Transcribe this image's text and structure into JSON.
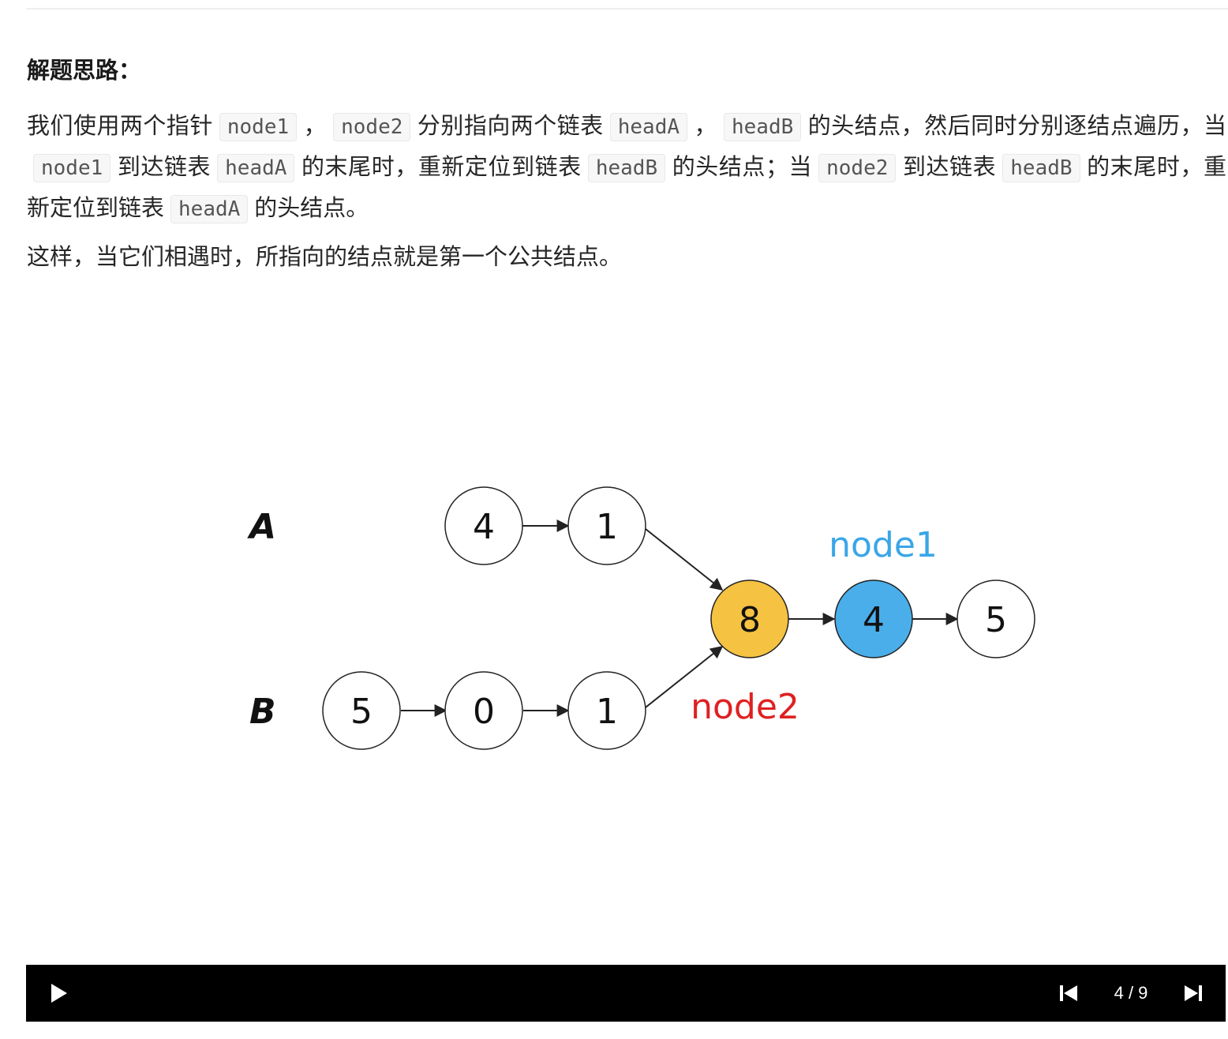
{
  "heading": "解题思路：",
  "paragraph1": [
    {
      "t": "text",
      "v": "我们使用两个指针"
    },
    {
      "t": "code",
      "v": "node1"
    },
    {
      "t": "text",
      "v": "，"
    },
    {
      "t": "code",
      "v": "node2"
    },
    {
      "t": "text",
      "v": "分别指向两个链表"
    },
    {
      "t": "code",
      "v": "headA"
    },
    {
      "t": "text",
      "v": "，"
    },
    {
      "t": "code",
      "v": "headB"
    },
    {
      "t": "text",
      "v": "的头结点，然后同时分别逐结点遍历，当"
    },
    {
      "t": "code",
      "v": "node1"
    },
    {
      "t": "text",
      "v": "到达链表"
    },
    {
      "t": "code",
      "v": "headA"
    },
    {
      "t": "text",
      "v": "的末尾时，重新定位到链表"
    },
    {
      "t": "code",
      "v": "headB"
    },
    {
      "t": "text",
      "v": "的头结点；当"
    },
    {
      "t": "code",
      "v": "node2"
    },
    {
      "t": "text",
      "v": "到达链表"
    },
    {
      "t": "code",
      "v": "headB"
    },
    {
      "t": "text",
      "v": "的末尾时，重新定位到链表"
    },
    {
      "t": "code",
      "v": "headA"
    },
    {
      "t": "text",
      "v": "的头结点。"
    }
  ],
  "paragraph2": "这样，当它们相遇时，所指向的结点就是第一个公共结点。",
  "diagram": {
    "list_a_label": "A",
    "list_b_label": "B",
    "list_a_nodes": [
      "4",
      "1"
    ],
    "list_b_nodes": [
      "5",
      "0",
      "1"
    ],
    "shared_nodes": [
      "8",
      "4",
      "5"
    ],
    "pointer1_label": "node1",
    "pointer2_label": "node2",
    "colors": {
      "shared_start_fill": "#f5c242",
      "pointer1_fill": "#4aaeea",
      "pointer1_text": "#3aa6e8",
      "pointer2_text": "#e02020",
      "node_fill": "#ffffff",
      "stroke": "#222222"
    }
  },
  "player": {
    "play_icon": "play-icon",
    "prev_icon": "skip-previous-icon",
    "next_icon": "skip-next-icon",
    "counter": "4 / 9"
  }
}
